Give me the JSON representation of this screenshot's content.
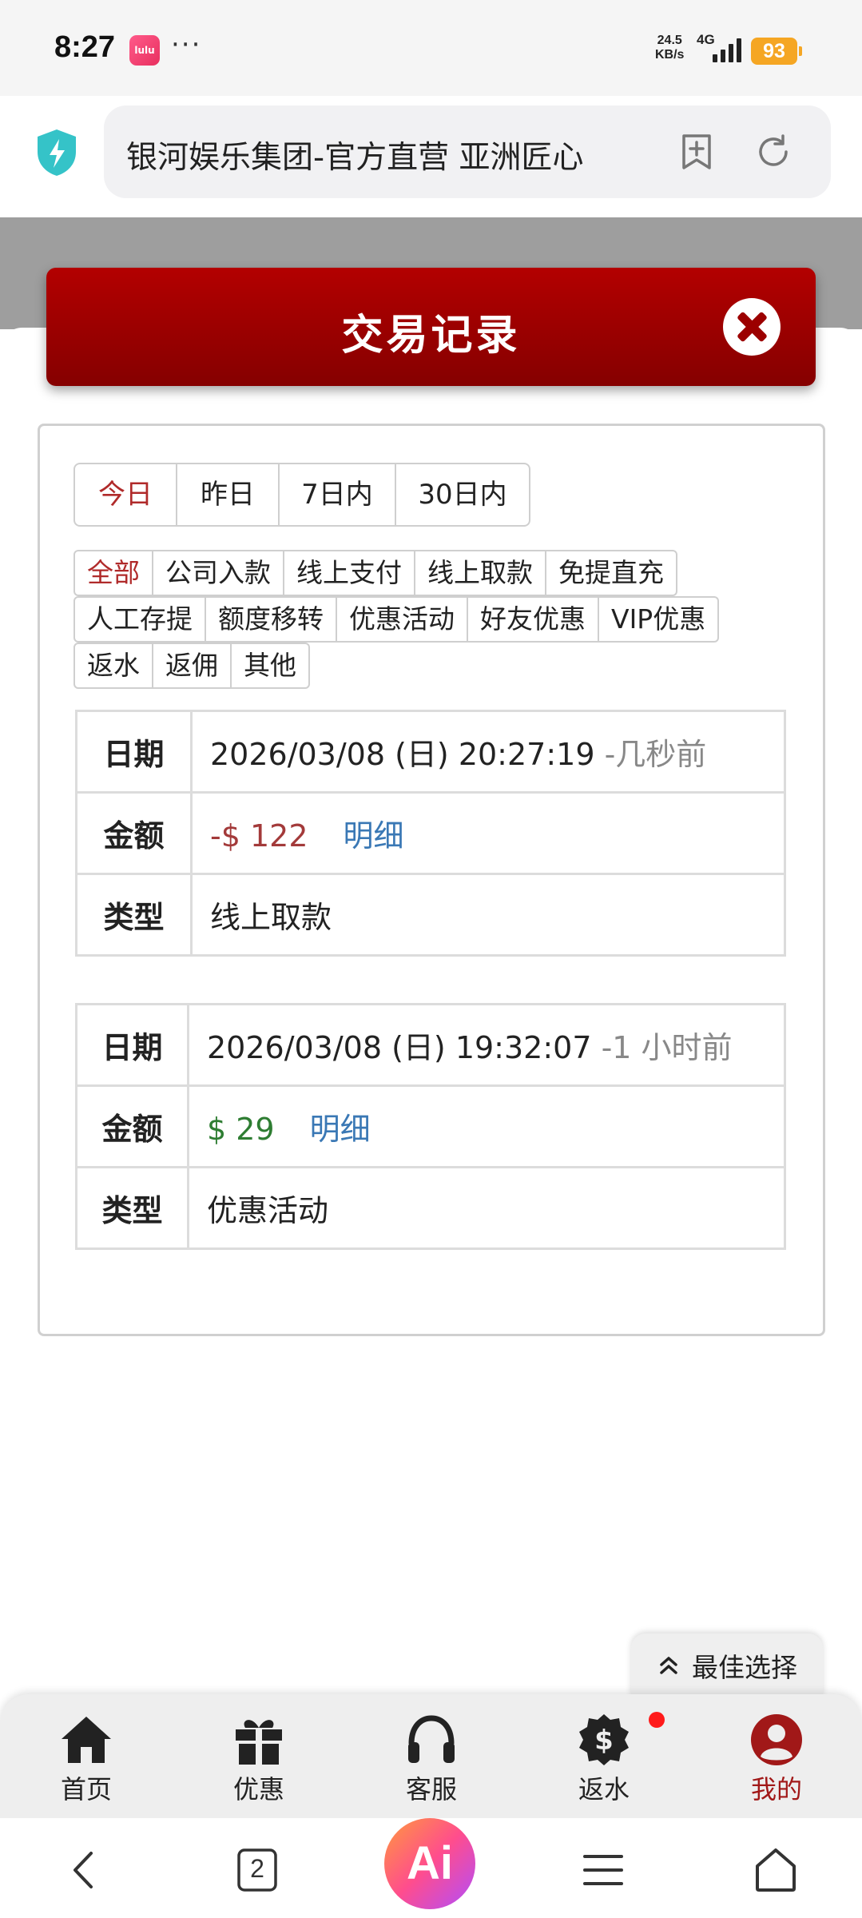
{
  "status_bar": {
    "time": "8:27",
    "app_icon_text": "lulu",
    "more": "···",
    "net_speed_value": "24.5",
    "net_speed_unit": "KB/s",
    "network": "4G",
    "battery": "93"
  },
  "browser": {
    "url_title": "银河娱乐集团-官方直营 亚洲匠心",
    "shield_icon": "shield-bolt-icon",
    "bookmark_icon": "add-bookmark-icon",
    "reload_icon": "reload-icon",
    "accent": "#35c3c8"
  },
  "dialog": {
    "title": "交易记录",
    "close_icon": "close-icon",
    "banner_color": "#a30000"
  },
  "range_tabs": [
    {
      "label": "今日",
      "active": true
    },
    {
      "label": "昨日",
      "active": false
    },
    {
      "label": "7日内",
      "active": false
    },
    {
      "label": "30日内",
      "active": false
    }
  ],
  "type_tabs": {
    "row1": [
      "全部",
      "公司入款",
      "线上支付",
      "线上取款",
      "免提直充"
    ],
    "row2": [
      "人工存提",
      "额度移转",
      "优惠活动",
      "好友优惠",
      "VIP优惠"
    ],
    "row3": [
      "返水",
      "返佣",
      "其他"
    ],
    "active": "全部"
  },
  "records": [
    {
      "date_label": "日期",
      "date": "2026/03/08 (日) 20:27:19",
      "ago": "-几秒前",
      "amount_label": "金额",
      "amount": "-$ 122",
      "detail": "明细",
      "type_label": "类型",
      "type": "线上取款",
      "amount_color": "#a33a3a"
    },
    {
      "date_label": "日期",
      "date": "2026/03/08 (日) 19:32:07",
      "ago": "-1 小时前",
      "amount_label": "金额",
      "amount": "$ 29",
      "detail": "明细",
      "type_label": "类型",
      "type": "优惠活动",
      "amount_color": "#2e7d32"
    }
  ],
  "best_choice": {
    "label": "最佳选择",
    "icon": "chevron-up-double-icon"
  },
  "bottom_nav": [
    {
      "label": "首页",
      "icon": "home-icon",
      "active": false
    },
    {
      "label": "优惠",
      "icon": "gift-icon",
      "active": false
    },
    {
      "label": "客服",
      "icon": "headset-icon",
      "active": false
    },
    {
      "label": "返水",
      "icon": "dollar-badge-icon",
      "active": false
    },
    {
      "label": "我的",
      "icon": "user-icon",
      "active": true
    }
  ],
  "system_nav": {
    "back_icon": "back-icon",
    "tabs_count": "2",
    "ai_label": "Ai",
    "menu_icon": "menu-icon",
    "home_icon": "home-outline-icon"
  }
}
